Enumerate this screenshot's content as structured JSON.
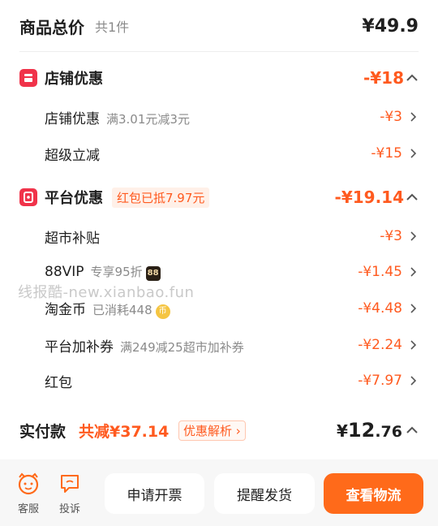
{
  "summary": {
    "title": "商品总价",
    "count": "共1件",
    "amount": "¥49.9"
  },
  "store_discount": {
    "icon": "store-icon",
    "title": "店铺优惠",
    "amount": "-¥18",
    "items": [
      {
        "label": "店铺优惠",
        "note": "满3.01元减3元",
        "amount": "-¥3"
      },
      {
        "label": "超级立减",
        "note": "",
        "amount": "-¥15"
      }
    ]
  },
  "platform_discount": {
    "icon": "platform-icon",
    "title": "平台优惠",
    "tag": "红包已抵7.97元",
    "amount": "-¥19.14",
    "items": [
      {
        "label": "超市补贴",
        "note": "",
        "amount": "-¥3"
      },
      {
        "label": "88VIP",
        "note": "专享95折",
        "badge": "88",
        "amount": "-¥1.45"
      },
      {
        "label": "淘金币",
        "note": "已消耗448",
        "badge": "币",
        "amount": "-¥4.48"
      },
      {
        "label": "平台加补券",
        "note": "满249减25超市加补券",
        "amount": "-¥2.24"
      },
      {
        "label": "红包",
        "note": "",
        "amount": "-¥7.97"
      }
    ]
  },
  "watermark": "线报酷-new.xianbao.fun",
  "payment": {
    "label": "实付款",
    "saved": "共减¥37.14",
    "tip": "优惠解析 ›",
    "currency": "¥",
    "amount_int": "12",
    "amount_dec": ".76"
  },
  "bottom_bar": {
    "service_label": "客服",
    "complaint_label": "投诉",
    "invoice_button": "申请开票",
    "remind_button": "提醒发货",
    "logistics_button": "查看物流"
  },
  "colors": {
    "accent": "#ff5a1f",
    "primary_button": "#ff6a1a",
    "section_icon": "#f0334a"
  }
}
